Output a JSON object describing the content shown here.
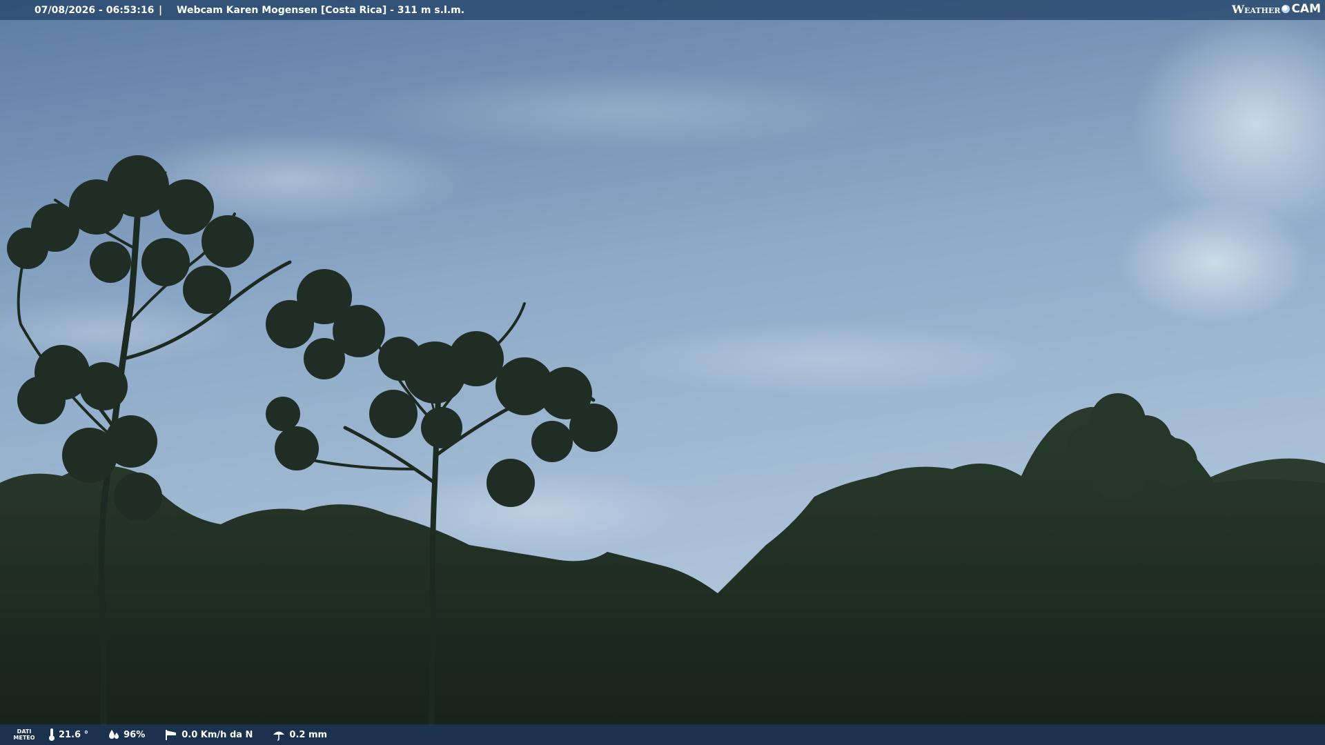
{
  "header": {
    "datetime": "07/08/2026 - 06:53:16",
    "separator": "|",
    "title": "Webcam Karen Mogensen [Costa Rica]  - 311 m s.l.m."
  },
  "logo": {
    "weather": "Weather",
    "cam": "CAM"
  },
  "footer": {
    "dati_line1": "DATI",
    "dati_line2": "METEO",
    "temperature": "21.6 °",
    "humidity": "96%",
    "wind": "0.0 Km/h da N",
    "rain": "0.2 mm"
  },
  "colors": {
    "sky_top": "#5a7aa0",
    "sky_bottom": "#a9c1d8",
    "foliage": "#1f2e22",
    "bar": "#28486c"
  },
  "icons": [
    "thermometer-icon",
    "humidity-drops-icon",
    "wind-sock-icon",
    "rain-umbrella-icon"
  ]
}
